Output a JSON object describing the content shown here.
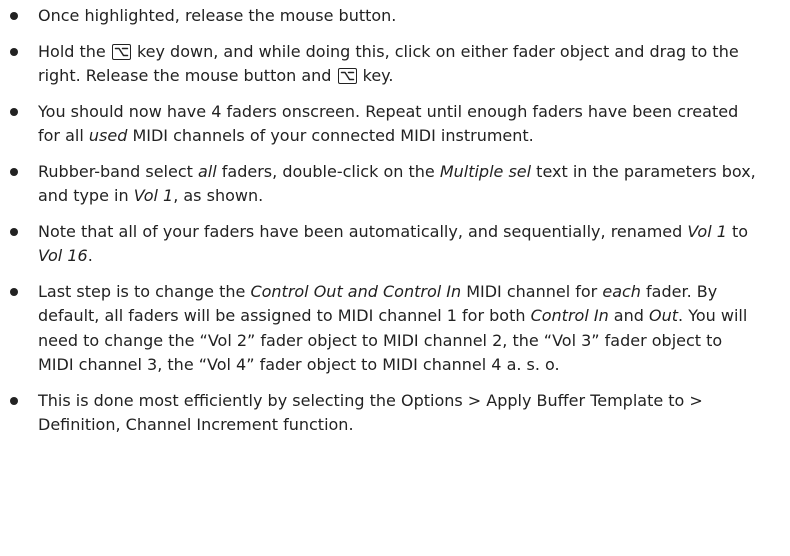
{
  "bullets": [
    {
      "t1": "Once highlighted, release the mouse button."
    },
    {
      "t1": "Hold the ",
      "key1": "option-key-icon",
      "t2": " key down, and while doing this, click on either fader object and drag to the right. Release the mouse button and ",
      "key2": "option-key-icon",
      "t3": " key."
    },
    {
      "t1": "You should now have 4 faders onscreen. Repeat until enough faders have been created for all ",
      "em1": "used",
      "t2": " MIDI channels of your connected MIDI instrument."
    },
    {
      "t1": "Rubber-band select ",
      "em1": "all",
      "t2": " faders, double-click on the ",
      "em2": "Multiple sel",
      "t3": " text in the parameters box, and type in ",
      "em3": "Vol 1",
      "t4": ", as shown."
    },
    {
      "t1": "Note that all of your faders have been automatically, and sequentially, renamed ",
      "em1": "Vol 1",
      "t2": " to ",
      "em2": "Vol 16",
      "t3": "."
    },
    {
      "t1": "Last step is to change the ",
      "em1": "Control Out and Control In",
      "t2": " MIDI channel for ",
      "em2": "each",
      "t3": " fader. By default, all faders will be assigned to MIDI channel 1 for both ",
      "em3": "Control In",
      "t4": " and ",
      "em4": "Out",
      "t5": ". You will need to change the “Vol 2” fader object to MIDI channel 2, the “Vol 3” fader object to MIDI channel 3, the “Vol 4” fader object to MIDI channel 4 a. s. o."
    },
    {
      "t1": "This is done most efficiently by selecting the Options > Apply Buffer Template to > Definition, Channel Increment function."
    }
  ]
}
